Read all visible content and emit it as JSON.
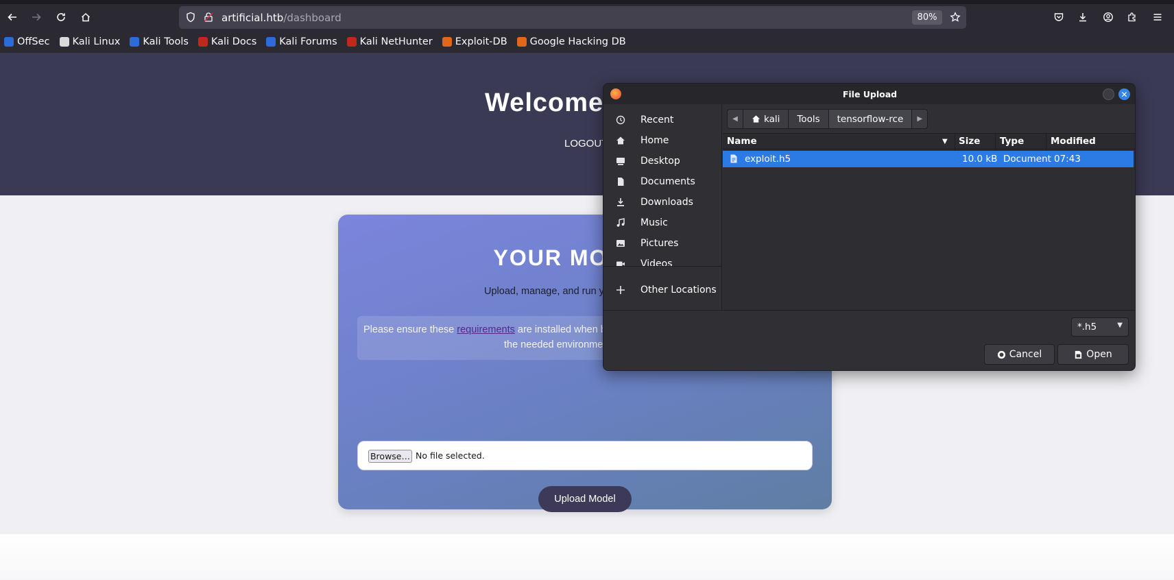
{
  "browser": {
    "url_host": "artificial.htb",
    "url_path": "/dashboard",
    "zoom": "80%",
    "bookmarks": [
      {
        "label": "OffSec",
        "color": "#2d6bd8"
      },
      {
        "label": "Kali Linux",
        "color": "#d9d9d9"
      },
      {
        "label": "Kali Tools",
        "color": "#2d6bd8"
      },
      {
        "label": "Kali Docs",
        "color": "#c0281c"
      },
      {
        "label": "Kali Forums",
        "color": "#2d6bd8"
      },
      {
        "label": "Kali NetHunter",
        "color": "#c0281c"
      },
      {
        "label": "Exploit-DB",
        "color": "#e0671c"
      },
      {
        "label": "Google Hacking DB",
        "color": "#e0671c"
      }
    ]
  },
  "page": {
    "welcome": "Welcome",
    "logout": "LOGOUT",
    "card_title": "YOUR MO",
    "card_subtitle": "Upload, manage, and run yo",
    "notice_before_link": "Please ensure these ",
    "notice_link": "requirements",
    "notice_after_link": " are installed when bu",
    "notice_line2": "the needed environme",
    "browse_label": "Browse…",
    "no_file": "No file selected.",
    "upload_label": "Upload Model"
  },
  "dialog": {
    "title": "File Upload",
    "places": [
      {
        "label": "Recent",
        "icon": "clock-icon"
      },
      {
        "label": "Home",
        "icon": "home-icon"
      },
      {
        "label": "Desktop",
        "icon": "desktop-icon"
      },
      {
        "label": "Documents",
        "icon": "document-icon"
      },
      {
        "label": "Downloads",
        "icon": "download-icon"
      },
      {
        "label": "Music",
        "icon": "music-icon"
      },
      {
        "label": "Pictures",
        "icon": "picture-icon"
      },
      {
        "label": "Videos",
        "icon": "video-icon"
      },
      {
        "label": "Other Locations",
        "icon": "plus-icon"
      }
    ],
    "path": [
      "kali",
      "Tools",
      "tensorflow-rce"
    ],
    "columns": {
      "name": "Name",
      "size": "Size",
      "type": "Type",
      "modified": "Modified"
    },
    "files": [
      {
        "name": "exploit.h5",
        "size": "10.0 kB",
        "type": "Document",
        "modified": "07:43",
        "selected": true
      }
    ],
    "filter": "*.h5",
    "cancel_label": "Cancel",
    "open_label": "Open",
    "accent": "#2c7be5"
  }
}
